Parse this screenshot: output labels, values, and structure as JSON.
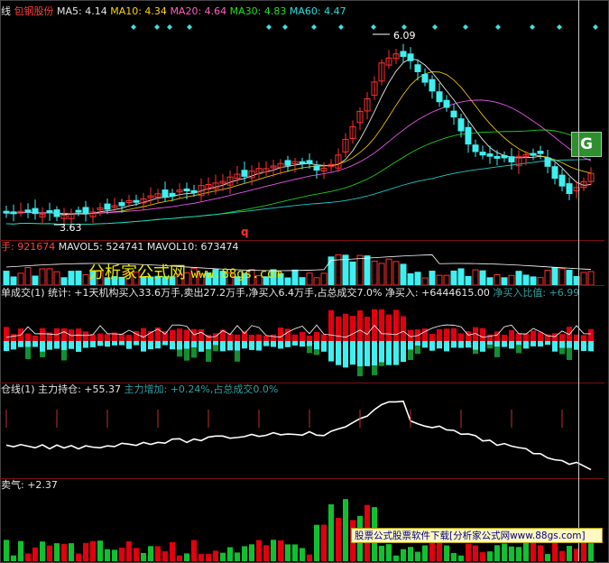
{
  "header": {
    "prefix": "线",
    "stock_name": "包钢股份",
    "ma5": "MA5: 4.14",
    "ma10": "MA10: 4.34",
    "ma20": "MA20: 4.64",
    "ma30": "MA30: 4.83",
    "ma60": "MA60: 4.47"
  },
  "price_pane": {
    "high_label": "6.09",
    "low_label": "3.63",
    "marker_q": "q",
    "logo_icon": "G"
  },
  "volume_pane": {
    "vol": "手: 921674",
    "mavol5": "MAVOL5: 524741",
    "mavol10": "MAVOL10: 673474"
  },
  "watermark": {
    "cn": "分析家公式网",
    "url": "www.88gs.com"
  },
  "order_pane": {
    "title": "单成交(1) 统计: +1天机构买入33.6万手,卖出27.2万手,净买入6.4万手,占总成交7.0%",
    "net_buy": "净买入: +6444615.00",
    "ratio": "净买入比值: +6.99"
  },
  "holding_pane": {
    "title": "仓线(1) 主力持仓: +55.37",
    "increase": "主力增加: +0.24%,占总成交0.0%"
  },
  "mood_pane": {
    "title": "卖气: +2.37"
  },
  "banner": {
    "text": "股票公式股票软件下载[分析家公式网www.88gs.com]"
  },
  "colors": {
    "up": "#ff3030",
    "down": "#40f0f0",
    "ma5": "#ffffff",
    "ma10": "#ffd400",
    "ma20": "#ff60ff",
    "ma30": "#20e020",
    "ma60": "#20e0e0"
  }
}
